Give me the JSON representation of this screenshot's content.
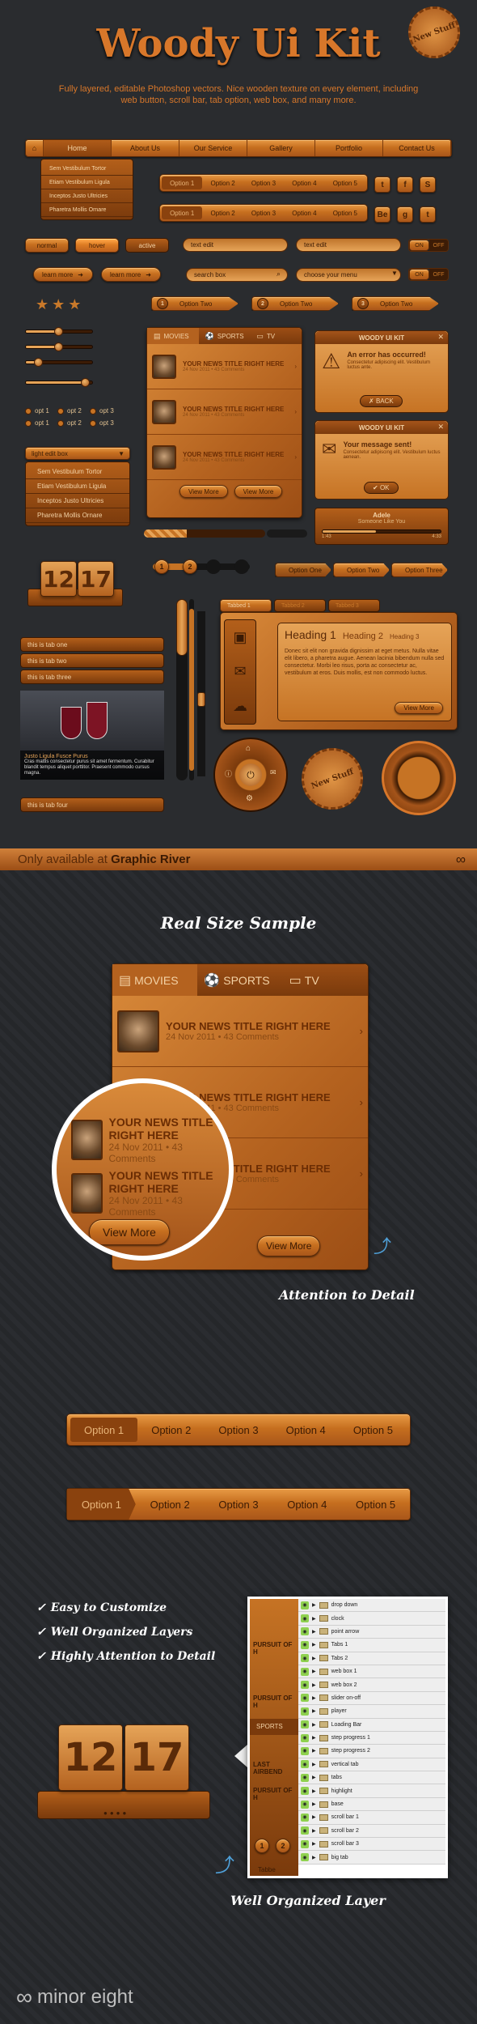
{
  "header": {
    "title": "Woody Ui Kit",
    "subtitle": "Fully layered, editable Photoshop vectors. Nice wooden texture on every element, including web button, scroll bar, tab option, web box, and many more.",
    "badge": "New Stuff"
  },
  "nav": {
    "items": [
      "Home",
      "About Us",
      "Our Service",
      "Gallery",
      "Portfolio",
      "Contact Us"
    ],
    "active": 1,
    "dropdown": [
      "Sem Vestibulum Tortor",
      "Etiam Vestibulum Ligula",
      "Inceptos Justo Ultricies",
      "Pharetra Mollis Ornare"
    ]
  },
  "segmented": {
    "options": [
      "Option 1",
      "Option 2",
      "Option 3",
      "Option 4",
      "Option 5"
    ]
  },
  "social": [
    "t",
    "f",
    "S",
    "Be",
    "g",
    "t"
  ],
  "buttons": {
    "normal": "normal",
    "hover": "hover",
    "active": "active",
    "learn_more": "learn more"
  },
  "inputs": {
    "text_edit": "text edit",
    "search_box": "search box",
    "choose_menu": "choose your menu"
  },
  "toggle": {
    "on": "ON",
    "off": "OFF"
  },
  "rating": {
    "value": 3,
    "max": 3,
    "glyph": "★"
  },
  "option_tabs": [
    {
      "num": "1",
      "label": "Option Two"
    },
    {
      "num": "2",
      "label": "Option Two"
    },
    {
      "num": "3",
      "label": "Option Two"
    }
  ],
  "sliders": [
    {
      "value": 0.5
    },
    {
      "value": 0.5
    },
    {
      "value": 0.2
    },
    {
      "value": 0.9
    }
  ],
  "radios": [
    {
      "label": "opt 1"
    },
    {
      "label": "opt 2"
    },
    {
      "label": "opt 3"
    },
    {
      "label": "opt 1"
    },
    {
      "label": "opt 2"
    },
    {
      "label": "opt 3"
    }
  ],
  "listbox": {
    "header": "light edit box",
    "items": [
      "Sem Vestibulum Tortor",
      "Etiam Vestibulum Ligula",
      "Inceptos Justo Ultricies",
      "Pharetra Mollis Ornare"
    ]
  },
  "news_tabs": [
    "MOVIES",
    "SPORTS",
    "TV"
  ],
  "news_items": [
    {
      "title": "YOUR NEWS TITLE RIGHT HERE",
      "meta": "24 Nov 2011 • 43 Comments"
    },
    {
      "title": "YOUR NEWS TITLE RIGHT HERE",
      "meta": "24 Nov 2011 • 43 Comments"
    },
    {
      "title": "YOUR NEWS TITLE RIGHT HERE",
      "meta": "24 Nov 2011 • 43 Comments"
    }
  ],
  "view_more": "View More",
  "alert1": {
    "title": "WOODY UI KIT",
    "heading": "An error has occurred!",
    "body": "Consectetur adipiscing elit. Vestibulum luctus ante.",
    "button": "BACK"
  },
  "alert2": {
    "title": "WOODY UI KIT",
    "heading": "Your message sent!",
    "body": "Consectetur adipiscing elit. Vestibulum luctus aenean.",
    "button": "OK"
  },
  "player": {
    "artist": "Adele",
    "song": "Someone Like You",
    "elapsed": "1:43",
    "total": "4:33",
    "progress": 0.45
  },
  "scroll_progress": 0.35,
  "clock": {
    "hour": "12",
    "minute": "17"
  },
  "steps": [
    "1",
    "2"
  ],
  "step_progress": 0.4,
  "arrow_options": [
    "Option One",
    "Option Two",
    "Option Three"
  ],
  "vertical_tabs": [
    "Tabbed 1",
    "Tabbed 2",
    "Tabbed 3"
  ],
  "headings": {
    "h1": "Heading 1",
    "h2": "Heading 2",
    "h3": "Heading 3",
    "body": "Donec sit elit non gravida dignissim at eget metus. Nulla vitae elit libero, a pharetra augue. Aenean lacinia bibendum nulla sed consectetur. Morbi leo risus, porta ac consectetur ac, vestibulum at eros. Duis mollis, est non commodo luctus.",
    "button": "View More"
  },
  "accordion": {
    "tabs": [
      "this is tab one",
      "this is tab two",
      "this is tab three"
    ],
    "caption_title": "Justo Ligula Fusce Purus",
    "caption_body": "Cras mattis consectetur purus sit amet fermentum. Curabitur blandit tempus aliquet porttitor. Praesent commodo cursus magna.",
    "last": "this is tab four"
  },
  "banner": {
    "prefix": "Only available at",
    "brand": "Graphic River"
  },
  "real_size": {
    "title": "Real Size Sample",
    "annotation": "Attention to Detail"
  },
  "features": [
    "Easy to Customize",
    "Well Organized Layers",
    "Highly Attention to Detail"
  ],
  "layers": [
    "drop down",
    "clock",
    "point arrow",
    "Tabs 1",
    "Tabs 2",
    "web box 1",
    "web box 2",
    "slider on-off",
    "player",
    "Loading Bar",
    "step progress 1",
    "step progress 2",
    "vertical tab",
    "tabs",
    "highlight",
    "base",
    "scroll bar 1",
    "scroll bar 2",
    "scroll bar 3",
    "big tab"
  ],
  "layer_caption": "Well Organized Layer",
  "preview_labels": {
    "pursuit": "PURSUIT OF H",
    "last": "LAST AIRBEND",
    "sports": "SPORTS",
    "tab": "Tabbe"
  },
  "footer": {
    "logo": "minor eight"
  }
}
